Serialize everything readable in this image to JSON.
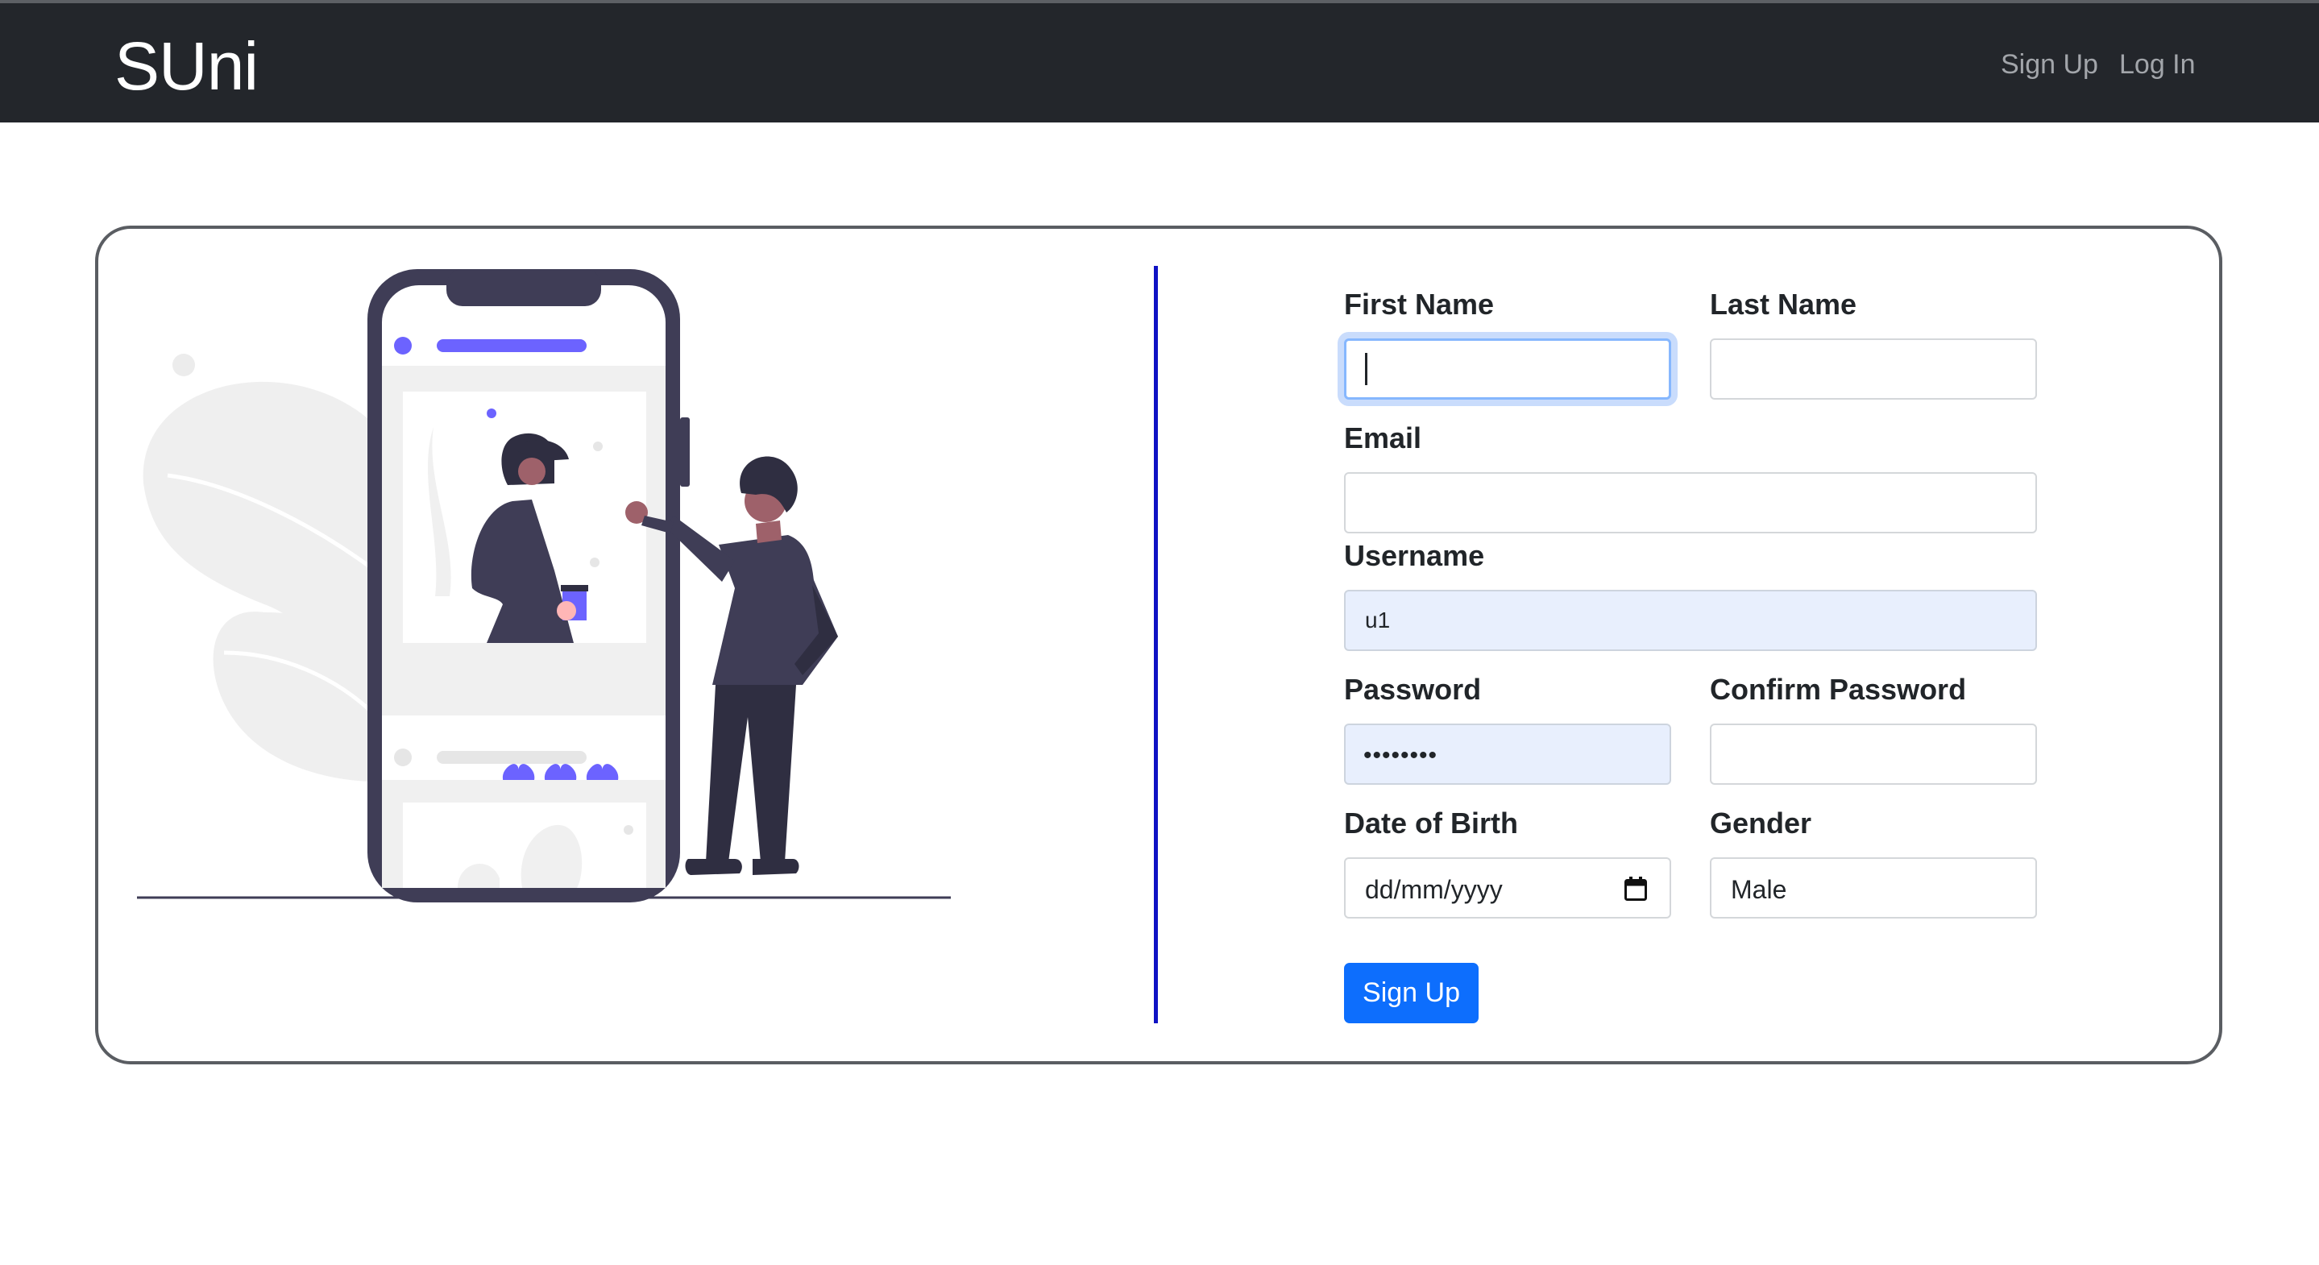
{
  "navbar": {
    "brand": "SUni",
    "links": [
      {
        "label": "Sign Up"
      },
      {
        "label": "Log In"
      }
    ]
  },
  "form": {
    "first_name": {
      "label": "First Name",
      "value": ""
    },
    "last_name": {
      "label": "Last Name",
      "value": ""
    },
    "email": {
      "label": "Email",
      "value": ""
    },
    "username": {
      "label": "Username",
      "value": "u1"
    },
    "password": {
      "label": "Password",
      "masked_value": "••••••••"
    },
    "confirm_password": {
      "label": "Confirm Password",
      "value": ""
    },
    "date_of_birth": {
      "label": "Date of Birth",
      "placeholder": "dd/mm/yyyy"
    },
    "gender": {
      "label": "Gender",
      "selected": "Male"
    },
    "submit_label": "Sign Up"
  },
  "colors": {
    "navbar_bg": "#23262b",
    "primary": "#0d6efd",
    "divider": "#0f12c4",
    "illustration_accent": "#6c63ff",
    "illustration_dark": "#3f3d56"
  }
}
